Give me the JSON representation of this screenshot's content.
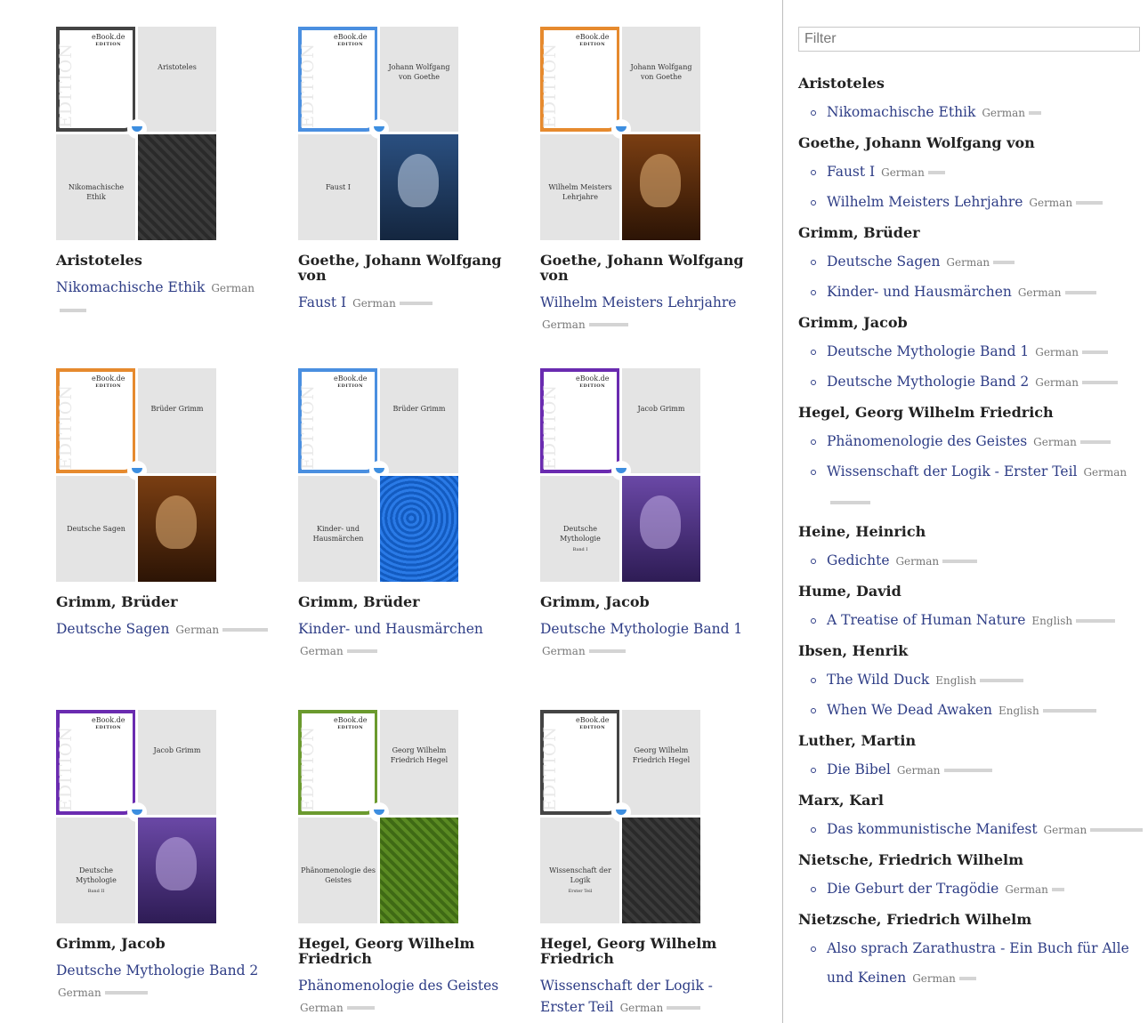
{
  "colors": {
    "link": "#2e3d86",
    "frame_black": "#444444",
    "frame_blue": "#4a8fe0",
    "frame_orange": "#e68a2e",
    "frame_purple": "#6a2bb0",
    "frame_green": "#6b9a2e",
    "cover_bg": "#e4e4e4"
  },
  "cover_brand": {
    "name": "eBook.de",
    "sub": "EDITION"
  },
  "cover_edition_text": "EDITION",
  "books": [
    {
      "author": "Aristoteles",
      "title": "Nikomachische Ethik",
      "lang": "German",
      "cover_author": "Aristoteles",
      "cover_title": "Nikomachische Ethik",
      "cover_sub": "",
      "frame": "black",
      "art": "pattern-dark"
    },
    {
      "author": "Goethe, Johann Wolfgang von",
      "title": "Faust I",
      "lang": "German",
      "cover_author": "Johann Wolfgang von Goethe",
      "cover_title": "Faust I",
      "cover_sub": "",
      "frame": "blue",
      "art": "portrait-blue"
    },
    {
      "author": "Goethe, Johann Wolfgang von",
      "title": "Wilhelm Meisters Lehrjahre",
      "lang": "German",
      "cover_author": "Johann Wolfgang von Goethe",
      "cover_title": "Wilhelm Meisters Lehrjahre",
      "cover_sub": "",
      "frame": "orange",
      "art": "portrait-orange"
    },
    {
      "author": "Grimm, Brüder",
      "title": "Deutsche Sagen",
      "lang": "German",
      "cover_author": "Brüder Grimm",
      "cover_title": "Deutsche Sagen",
      "cover_sub": "",
      "frame": "orange",
      "art": "portrait-orange"
    },
    {
      "author": "Grimm, Brüder",
      "title": "Kinder- und Hausmärchen",
      "lang": "German",
      "cover_author": "Brüder Grimm",
      "cover_title": "Kinder- und Hausmärchen",
      "cover_sub": "",
      "frame": "blue",
      "art": "illustration-blue"
    },
    {
      "author": "Grimm, Jacob",
      "title": "Deutsche Mythologie Band 1",
      "lang": "German",
      "cover_author": "Jacob Grimm",
      "cover_title": "Deutsche Mythologie",
      "cover_sub": "Band I",
      "frame": "purple",
      "art": "portrait-purple"
    },
    {
      "author": "Grimm, Jacob",
      "title": "Deutsche Mythologie Band 2",
      "lang": "German",
      "cover_author": "Jacob Grimm",
      "cover_title": "Deutsche Mythologie",
      "cover_sub": "Band II",
      "frame": "purple",
      "art": "portrait-purple"
    },
    {
      "author": "Hegel, Georg Wilhelm Friedrich",
      "title": "Phänomenologie des Geistes",
      "lang": "German",
      "cover_author": "Georg Wilhelm Friedrich Hegel",
      "cover_title": "Phänomenologie des Geistes",
      "cover_sub": "",
      "frame": "green",
      "art": "pattern-green"
    },
    {
      "author": "Hegel, Georg Wilhelm Friedrich",
      "title": "Wissenschaft der Logik - Erster Teil",
      "lang": "German",
      "cover_author": "Georg Wilhelm Friedrich Hegel",
      "cover_title": "Wissenschaft der Logik",
      "cover_sub": "Erster Teil",
      "frame": "black",
      "art": "pattern-dark"
    }
  ],
  "sidebar": {
    "filter_placeholder": "Filter",
    "groups": [
      {
        "author": "Aristoteles",
        "items": [
          {
            "title": "Nikomachische Ethik",
            "lang": "German"
          }
        ]
      },
      {
        "author": "Goethe, Johann Wolfgang von",
        "items": [
          {
            "title": "Faust I",
            "lang": "German"
          },
          {
            "title": "Wilhelm Meisters Lehrjahre",
            "lang": "German"
          }
        ]
      },
      {
        "author": "Grimm, Brüder",
        "items": [
          {
            "title": "Deutsche Sagen",
            "lang": "German"
          },
          {
            "title": "Kinder- und Hausmärchen",
            "lang": "German"
          }
        ]
      },
      {
        "author": "Grimm, Jacob",
        "items": [
          {
            "title": "Deutsche Mythologie Band 1",
            "lang": "German"
          },
          {
            "title": "Deutsche Mythologie Band 2",
            "lang": "German"
          }
        ]
      },
      {
        "author": "Hegel, Georg Wilhelm Friedrich",
        "items": [
          {
            "title": "Phänomenologie des Geistes",
            "lang": "German"
          },
          {
            "title": "Wissenschaft der Logik - Erster Teil",
            "lang": "German"
          }
        ]
      },
      {
        "author": "Heine, Heinrich",
        "items": [
          {
            "title": "Gedichte",
            "lang": "German"
          }
        ]
      },
      {
        "author": "Hume, David",
        "items": [
          {
            "title": "A Treatise of Human Nature",
            "lang": "English"
          }
        ]
      },
      {
        "author": "Ibsen, Henrik",
        "items": [
          {
            "title": "The Wild Duck",
            "lang": "English"
          },
          {
            "title": "When We Dead Awaken",
            "lang": "English"
          }
        ]
      },
      {
        "author": "Luther, Martin",
        "items": [
          {
            "title": "Die Bibel",
            "lang": "German"
          }
        ]
      },
      {
        "author": "Marx, Karl",
        "items": [
          {
            "title": "Das kommunistische Manifest",
            "lang": "German"
          }
        ]
      },
      {
        "author": "Nietsche, Friedrich Wilhelm",
        "items": [
          {
            "title": "Die Geburt der Tragödie",
            "lang": "German"
          }
        ]
      },
      {
        "author": "Nietzsche, Friedrich Wilhelm",
        "items": [
          {
            "title": "Also sprach Zarathustra - Ein Buch für Alle und Keinen",
            "lang": "German"
          }
        ]
      }
    ]
  }
}
